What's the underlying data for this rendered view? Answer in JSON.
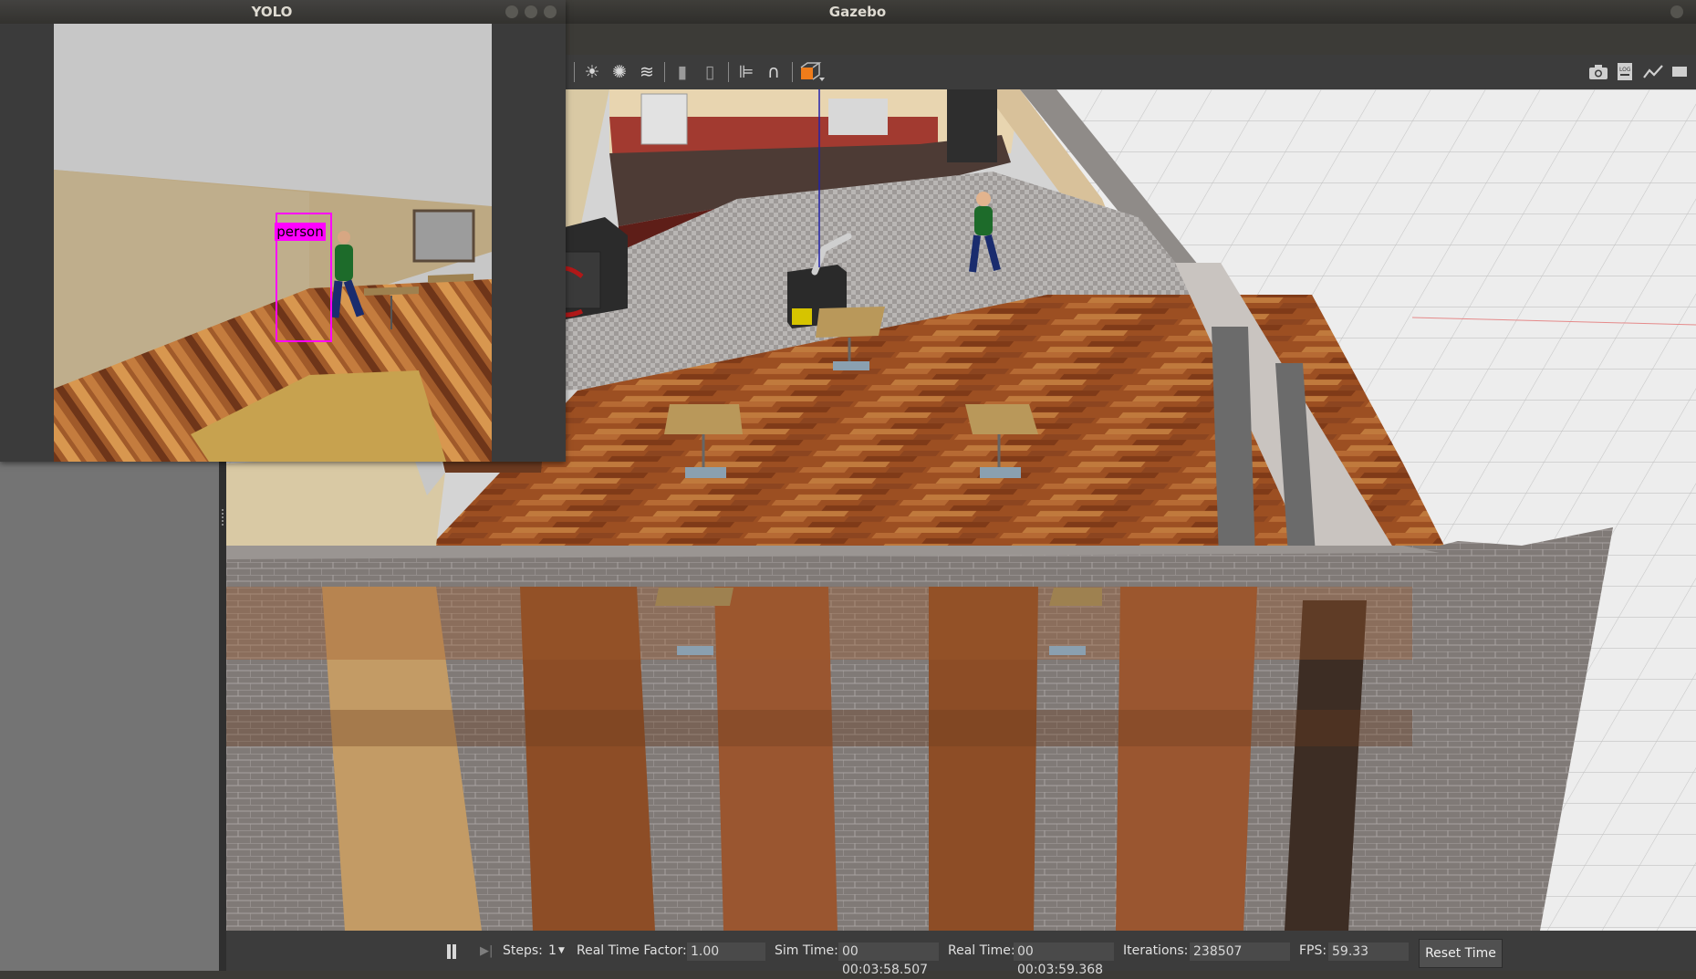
{
  "gazebo": {
    "title": "Gazebo",
    "toolbar": {
      "left_tools": [
        "sun-light-icon",
        "point-light-icon",
        "directional-light-icon",
        "copy-icon",
        "paste-icon",
        "align-icon",
        "snap-magnet-icon",
        "change-view-icon"
      ],
      "right_tools": [
        "screenshot-icon",
        "log-icon",
        "plot-icon",
        "video-icon"
      ],
      "log_label": "LOG"
    },
    "status": {
      "steps_label": "Steps:",
      "steps_value": "1",
      "real_time_factor_label": "Real Time Factor:",
      "real_time_factor_value": "1.00",
      "sim_time_label": "Sim Time:",
      "sim_time_value": "00 00:03:58.507",
      "real_time_label": "Real Time:",
      "real_time_value": "00 00:03:59.368",
      "iterations_label": "Iterations:",
      "iterations_value": "238507",
      "fps_label": "FPS:",
      "fps_value": "59.33",
      "reset_time_label": "Reset Time"
    }
  },
  "yolo": {
    "title": "YOLO",
    "detection_label": "person",
    "detection_color": "#ff00ff"
  },
  "colors": {
    "accent_orange": "#f07c1a",
    "floor_wood": "#a0582a",
    "brick_wall": "#7e7874"
  }
}
